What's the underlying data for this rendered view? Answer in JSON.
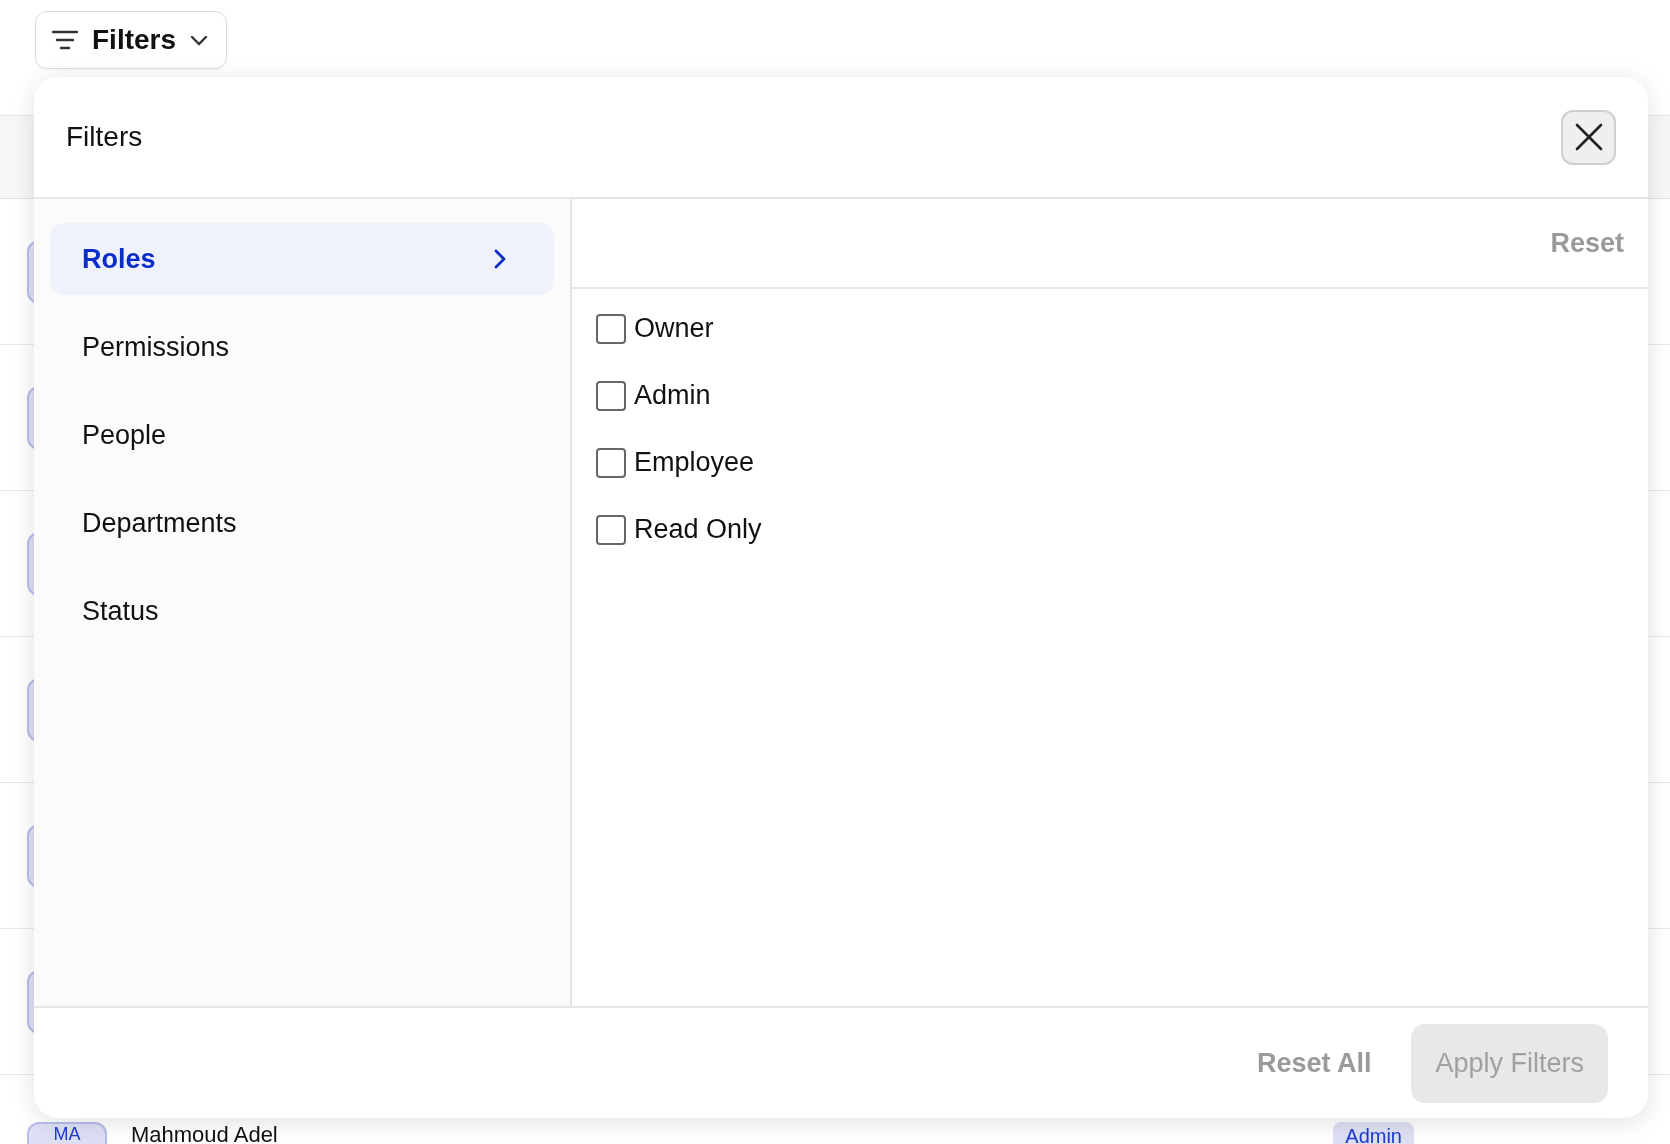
{
  "filter_button": {
    "label": "Filters",
    "expanded": true
  },
  "table": {
    "rows": [
      {
        "kind": "covered"
      },
      {
        "kind": "covered"
      },
      {
        "kind": "covered"
      },
      {
        "kind": "covered"
      },
      {
        "kind": "covered"
      },
      {
        "kind": "covered"
      },
      {
        "kind": "person",
        "initials": "MA",
        "name": "Mahmoud Adel",
        "role": "Admin"
      }
    ]
  },
  "modal": {
    "title": "Filters",
    "categories": [
      {
        "label": "Roles",
        "selected": true
      },
      {
        "label": "Permissions",
        "selected": false
      },
      {
        "label": "People",
        "selected": false
      },
      {
        "label": "Departments",
        "selected": false
      },
      {
        "label": "Status",
        "selected": false
      }
    ],
    "reset": "Reset",
    "options": [
      {
        "label": "Owner",
        "checked": false
      },
      {
        "label": "Admin",
        "checked": false
      },
      {
        "label": "Employee",
        "checked": false
      },
      {
        "label": "Read Only",
        "checked": false
      }
    ],
    "footer": {
      "reset_all": "Reset All",
      "apply": {
        "label": "Apply Filters",
        "disabled": true
      }
    }
  }
}
